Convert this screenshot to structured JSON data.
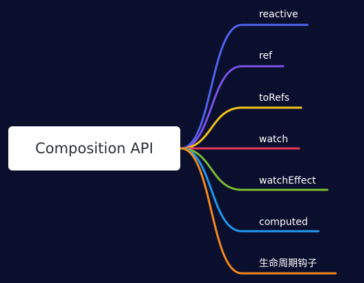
{
  "root": {
    "label": "Composition API"
  },
  "branches": [
    {
      "label": "reactive",
      "color": "#4f63f0"
    },
    {
      "label": "ref",
      "color": "#7b52e6"
    },
    {
      "label": "toRefs",
      "color": "#f5c518"
    },
    {
      "label": "watch",
      "color": "#e8385a"
    },
    {
      "label": "watchEffect",
      "color": "#7dbd2e"
    },
    {
      "label": "computed",
      "color": "#1e9bf0"
    },
    {
      "label": "生命周期钩子",
      "color": "#f58a1c"
    }
  ]
}
